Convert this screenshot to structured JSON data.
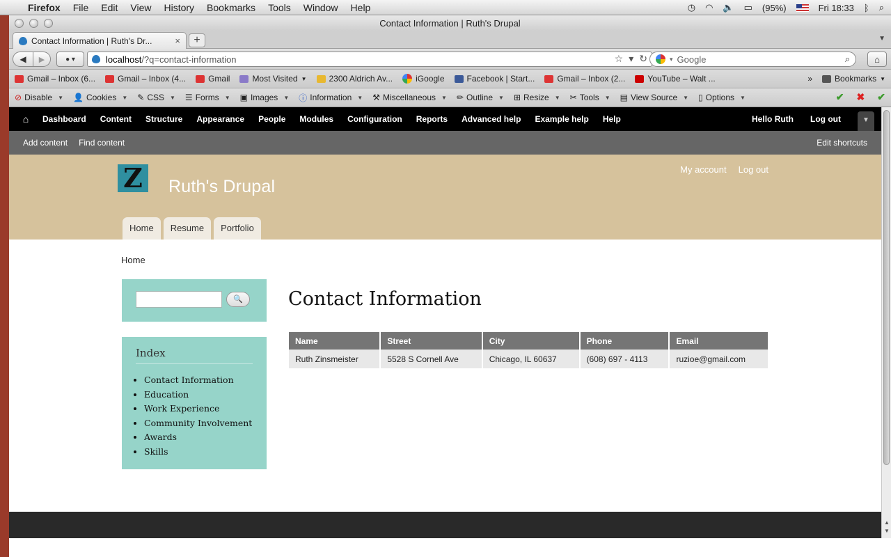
{
  "mac_menubar": {
    "app": "Firefox",
    "menus": [
      "File",
      "Edit",
      "View",
      "History",
      "Bookmarks",
      "Tools",
      "Window",
      "Help"
    ],
    "battery": "(95%)",
    "clock": "Fri 18:33"
  },
  "window": {
    "title": "Contact Information | Ruth's Drupal"
  },
  "tabs": [
    {
      "label": "Contact Information | Ruth's Dr...",
      "active": true
    }
  ],
  "navbar": {
    "url_host": "localhost",
    "url_path": "/?q=contact-information",
    "search_placeholder": "Google"
  },
  "bookmarks": {
    "items": [
      {
        "label": "Gmail – Inbox (6...",
        "icon": "gmail-icon"
      },
      {
        "label": "Gmail – Inbox (4...",
        "icon": "gmail-icon"
      },
      {
        "label": "Gmail",
        "icon": "gmail-icon"
      },
      {
        "label": "Most Visited",
        "icon": "folder-icon"
      },
      {
        "label": "2300 Aldrich Av...",
        "icon": "yahoo-icon"
      },
      {
        "label": "iGoogle",
        "icon": "google-icon"
      },
      {
        "label": "Facebook | Start...",
        "icon": "facebook-icon"
      },
      {
        "label": "Gmail – Inbox (2...",
        "icon": "gmail-icon"
      },
      {
        "label": "YouTube – Walt ...",
        "icon": "youtube-icon"
      }
    ],
    "overflow": "»",
    "menu_label": "Bookmarks"
  },
  "devbar": {
    "items": [
      "Disable",
      "Cookies",
      "CSS",
      "Forms",
      "Images",
      "Information",
      "Miscellaneous",
      "Outline",
      "Resize",
      "Tools",
      "View Source",
      "Options"
    ]
  },
  "admin_toolbar": {
    "items": [
      "Dashboard",
      "Content",
      "Structure",
      "Appearance",
      "People",
      "Modules",
      "Configuration",
      "Reports",
      "Advanced help",
      "Example help",
      "Help"
    ],
    "greeting": "Hello Ruth",
    "logout": "Log out"
  },
  "shortcuts": {
    "items": [
      "Add content",
      "Find content"
    ],
    "edit": "Edit shortcuts"
  },
  "site": {
    "logo_letter": "Z",
    "name": "Ruth's Drupal",
    "secondary_links": [
      "My account",
      "Log out"
    ],
    "primary_tabs": [
      "Home",
      "Resume",
      "Portfolio"
    ]
  },
  "breadcrumb": "Home",
  "sidebar": {
    "index_title": "Index",
    "index_items": [
      "Contact Information",
      "Education",
      "Work Experience",
      "Community Involvement",
      "Awards",
      "Skills"
    ]
  },
  "content": {
    "title": "Contact Information",
    "table": {
      "headers": [
        "Name",
        "Street",
        "City",
        "Phone",
        "Email"
      ],
      "rows": [
        [
          "Ruth Zinsmeister",
          "5528 S Cornell Ave",
          "Chicago, IL 60637",
          "(608) 697 - 4113",
          "ruzioe@gmail.com"
        ]
      ]
    }
  },
  "colors": {
    "header_bg": "#d6c29c",
    "block_bg": "#96d4c9",
    "table_header_bg": "#757575",
    "admin_bar_bg": "#000000",
    "footer_bg": "#292929"
  }
}
